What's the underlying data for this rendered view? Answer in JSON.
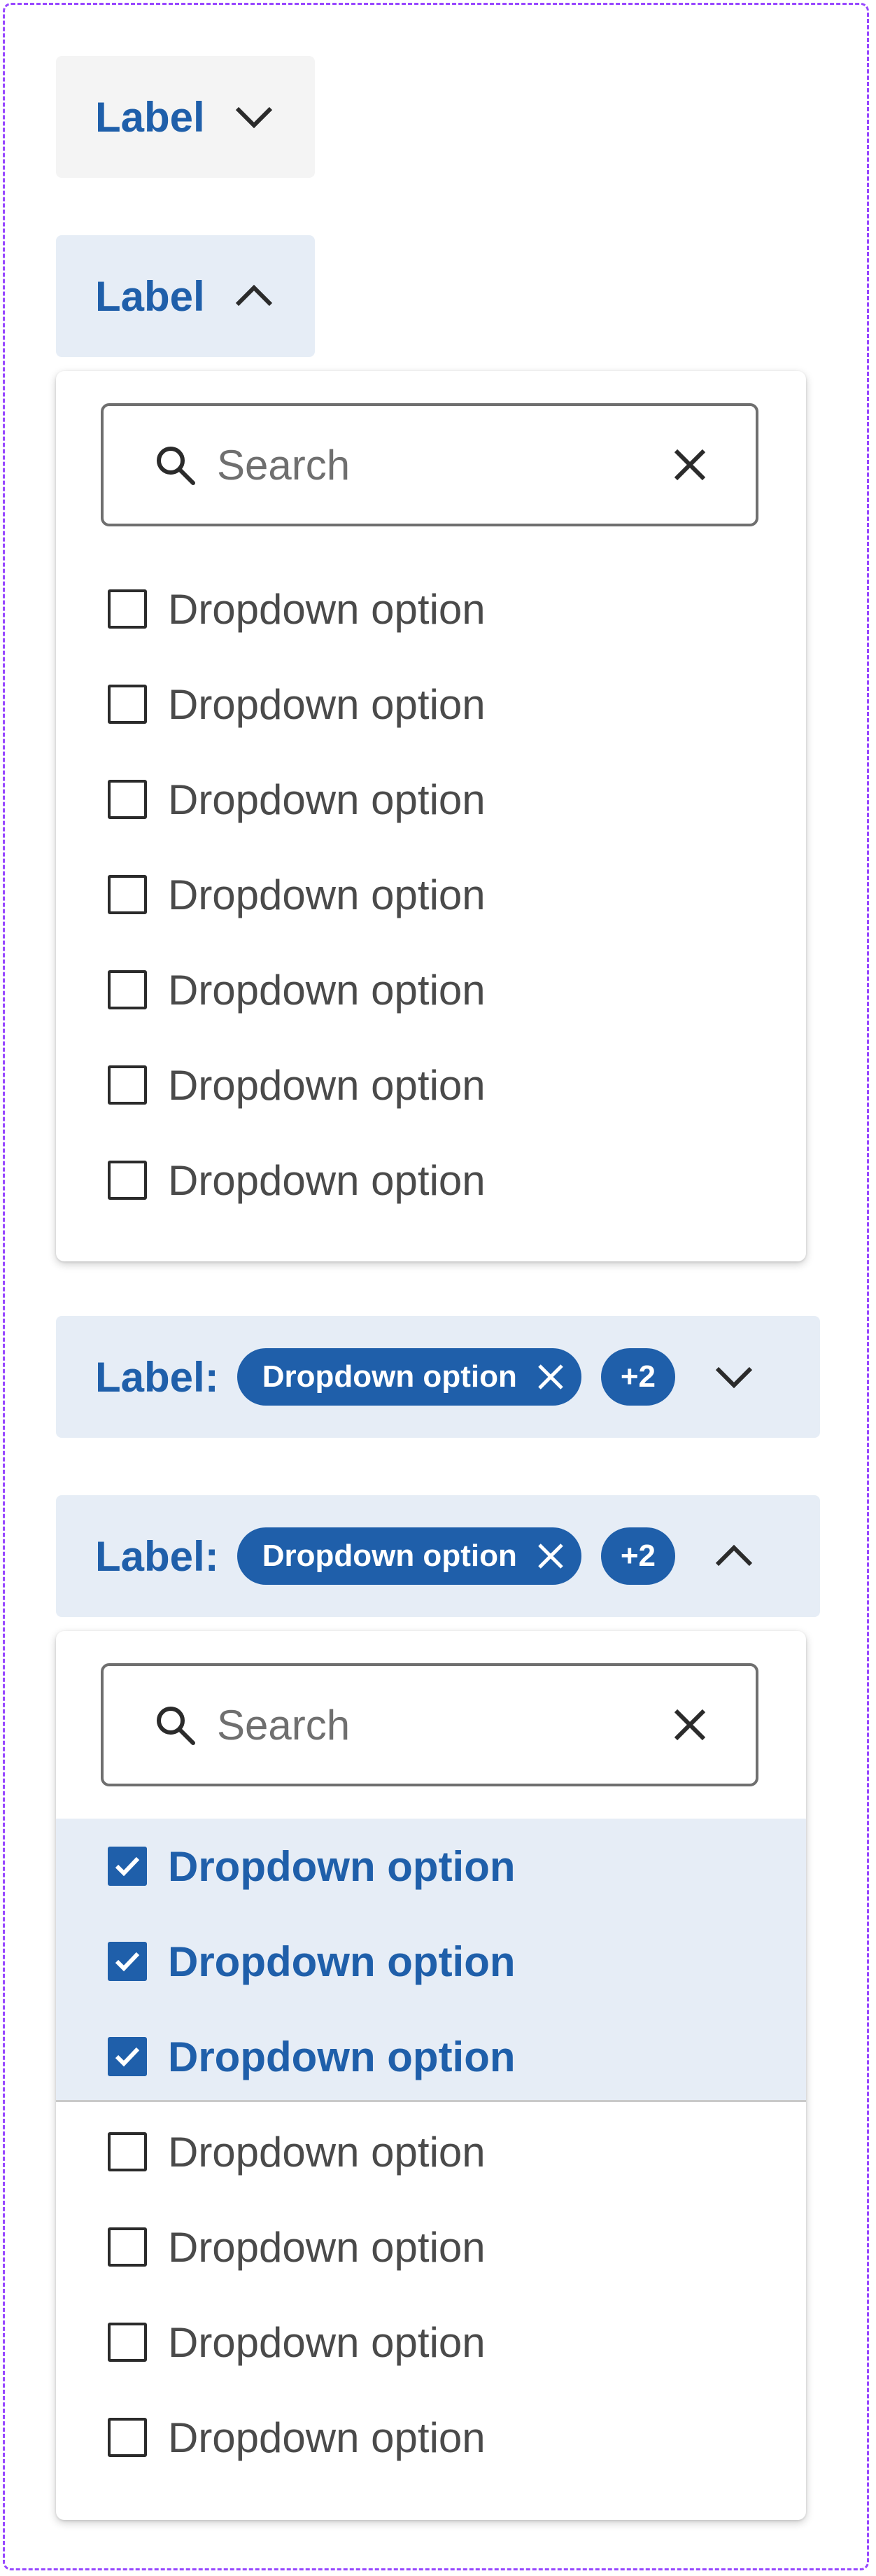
{
  "dropdown_closed": {
    "label": "Label"
  },
  "dropdown_open": {
    "label": "Label",
    "search": {
      "placeholder": "Search",
      "value": ""
    },
    "options": [
      "Dropdown option",
      "Dropdown option",
      "Dropdown option",
      "Dropdown option",
      "Dropdown option",
      "Dropdown option",
      "Dropdown option"
    ]
  },
  "dropdown_selected_closed": {
    "label": "Label:",
    "chip": "Dropdown option",
    "count": "+2"
  },
  "dropdown_selected_open": {
    "label": "Label:",
    "chip": "Dropdown option",
    "count": "+2",
    "search": {
      "placeholder": "Search",
      "value": ""
    },
    "selected_options": [
      "Dropdown option",
      "Dropdown option",
      "Dropdown option"
    ],
    "options": [
      "Dropdown option",
      "Dropdown option",
      "Dropdown option",
      "Dropdown option"
    ]
  },
  "colors": {
    "accent": "#1f5faa",
    "trigger_open_bg": "#e6edf6",
    "trigger_closed_bg": "#f4f4f4",
    "frame_border": "#9747ff"
  },
  "icons": {
    "closed": "chevron-down-icon",
    "open": "chevron-up-icon",
    "search": "search-icon",
    "clear": "close-icon",
    "chip_remove": "close-icon",
    "checked": "checkmark-icon"
  }
}
